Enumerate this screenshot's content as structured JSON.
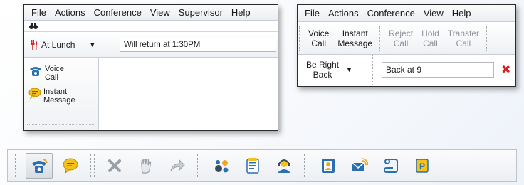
{
  "panel_a": {
    "menu": [
      "File",
      "Actions",
      "Conference",
      "View",
      "Supervisor",
      "Help"
    ],
    "status": {
      "selected": "At Lunch",
      "message": "Will return at 1:30PM"
    },
    "sidebar": [
      {
        "label_line1": "Voice",
        "label_line2": "Call",
        "icon": "phone-icon"
      },
      {
        "label_line1": "Instant",
        "label_line2": "Message",
        "icon": "chat-bubble-icon"
      }
    ]
  },
  "panel_b": {
    "menu": [
      "File",
      "Actions",
      "Conference",
      "View",
      "Help"
    ],
    "buttons": [
      {
        "line1": "Voice",
        "line2": "Call",
        "enabled": true
      },
      {
        "line1": "Instant",
        "line2": "Message",
        "enabled": true
      },
      {
        "line1": "Reject",
        "line2": "Call",
        "enabled": false
      },
      {
        "line1": "Hold",
        "line2": "Call",
        "enabled": false
      },
      {
        "line1": "Transfer",
        "line2": "Call",
        "enabled": false
      }
    ],
    "status": {
      "selected_line1": "Be Right",
      "selected_line2": "Back",
      "message": "Back at 9"
    }
  },
  "toolbar": {
    "icons": [
      "phone-icon",
      "chat-bubble-icon",
      "reject-call-icon",
      "hold-hand-icon",
      "transfer-arrow-icon",
      "people-icon",
      "notes-icon",
      "agent-icon",
      "contact-card-icon",
      "email-icon",
      "script-icon",
      "presence-icon"
    ]
  },
  "colors": {
    "accent": "#2a6fb0",
    "error": "#d61f1f",
    "highlight": "#f5c21c"
  }
}
